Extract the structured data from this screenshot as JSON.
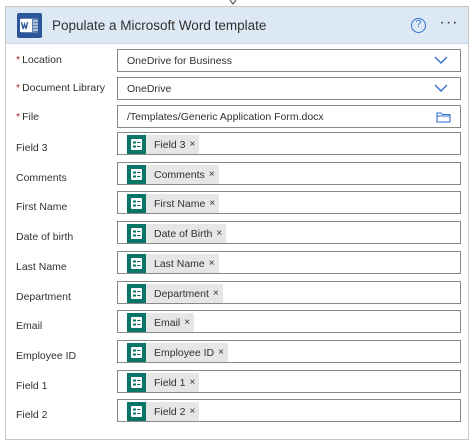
{
  "header": {
    "title": "Populate a Microsoft Word template",
    "help_symbol": "?",
    "more_symbol": "···",
    "accent_color": "#2b579a",
    "header_bg": "#dde8f5"
  },
  "required_marker": "*",
  "location": {
    "label": "Location",
    "value": "OneDrive for Business"
  },
  "document_library": {
    "label": "Document Library",
    "value": "OneDrive"
  },
  "file": {
    "label": "File",
    "value": "/Templates/Generic Application Form.docx"
  },
  "token_color": "#077568",
  "close_symbol": "×",
  "fields": [
    {
      "label": "Field 3",
      "token": "Field 3"
    },
    {
      "label": "Comments",
      "token": "Comments"
    },
    {
      "label": "First Name",
      "token": "First Name"
    },
    {
      "label": "Date of birth",
      "token": "Date of Birth"
    },
    {
      "label": "Last Name",
      "token": "Last Name"
    },
    {
      "label": "Department",
      "token": "Department"
    },
    {
      "label": "Email",
      "token": "Email"
    },
    {
      "label": "Employee ID",
      "token": "Employee ID"
    },
    {
      "label": "Field 1",
      "token": "Field 1"
    },
    {
      "label": "Field 2",
      "token": "Field 2"
    }
  ]
}
